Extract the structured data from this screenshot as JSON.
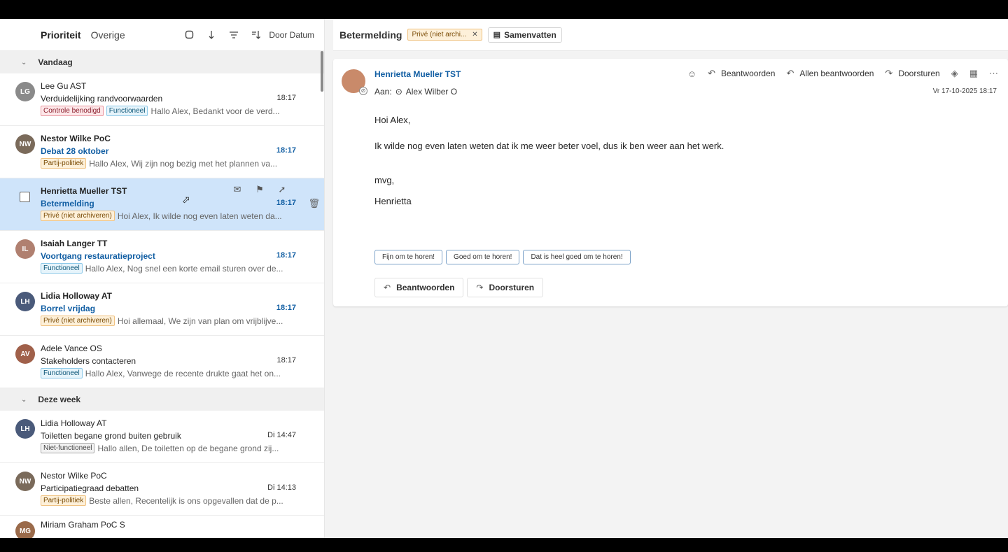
{
  "list": {
    "tabs": [
      "Prioriteit",
      "Overige"
    ],
    "sort_label": "Door Datum",
    "groups": {
      "today": "Vandaag",
      "week": "Deze week"
    },
    "items": [
      {
        "sender": "Lee Gu AST",
        "subject": "Verduidelijking randvoorwaarden",
        "time": "18:17",
        "tags": [
          "Controle benodigd",
          "Functioneel"
        ],
        "preview": "Hallo Alex, Bedankt voor de verd..."
      },
      {
        "sender": "Nestor Wilke PoC",
        "subject": "Debat 28 oktober",
        "time": "18:17",
        "tags": [
          "Partij-politiek"
        ],
        "preview": "Hallo Alex, Wij zijn nog bezig met het plannen va..."
      },
      {
        "sender": "Henrietta Mueller TST",
        "subject": "Betermelding",
        "time": "18:17",
        "tags": [
          "Privé (niet archiveren)"
        ],
        "preview": "Hoi Alex, Ik wilde nog even laten weten da..."
      },
      {
        "sender": "Isaiah Langer TT",
        "subject": "Voortgang restauratieproject",
        "time": "18:17",
        "tags": [
          "Functioneel"
        ],
        "preview": "Hallo Alex, Nog snel een korte email sturen over de..."
      },
      {
        "sender": "Lidia Holloway AT",
        "subject": "Borrel vrijdag",
        "time": "18:17",
        "tags": [
          "Privé (niet archiveren)"
        ],
        "preview": "Hoi allemaal, We zijn van plan om vrijblijve..."
      },
      {
        "sender": "Adele Vance OS",
        "subject": "Stakeholders contacteren",
        "time": "18:17",
        "tags": [
          "Functioneel"
        ],
        "preview": "Hallo Alex, Vanwege de recente drukte gaat het on..."
      },
      {
        "sender": "Lidia Holloway AT",
        "subject": "Toiletten begane grond buiten gebruik",
        "time": "Di 14:47",
        "tags": [
          "Niet-functioneel"
        ],
        "preview": "Hallo allen, De toiletten op de begane grond zij..."
      },
      {
        "sender": "Nestor Wilke PoC",
        "subject": "Participatiegraad debatten",
        "time": "Di 14:13",
        "tags": [
          "Partij-politiek"
        ],
        "preview": "Beste allen, Recentelijk is ons opgevallen dat de p..."
      },
      {
        "sender": "Miriam Graham PoC S",
        "subject": "",
        "time": "",
        "tags": [],
        "preview": ""
      }
    ]
  },
  "reading": {
    "subject": "Betermelding",
    "category_chip": "Privé (niet archi...",
    "summarize_label": "Samenvatten",
    "from": "Henrietta Mueller TST",
    "to_label": "Aan:",
    "to_name": "Alex Wilber O",
    "date": "Vr 17-10-2025 18:17",
    "actions": {
      "reply": "Beantwoorden",
      "reply_all": "Allen beantwoorden",
      "forward": "Doorsturen"
    },
    "body": {
      "greeting": "Hoi Alex,",
      "line1": "Ik wilde nog even laten weten dat ik me weer beter voel, dus ik ben weer aan het werk.",
      "closing": "mvg,",
      "signature": "Henrietta"
    },
    "suggestions": [
      "Fijn om te horen!",
      "Goed om te horen!",
      "Dat is heel goed om te horen!"
    ],
    "bottom_reply": "Beantwoorden",
    "bottom_forward": "Doorsturen"
  },
  "colors": {
    "accent": "#115ea3",
    "selected_row": "#cfe4fa"
  },
  "icons": [
    "select-all-icon",
    "sort-icon",
    "filter-icon",
    "sort-order-icon",
    "chevron-down-icon",
    "mark-read-icon",
    "flag-icon",
    "pin-icon",
    "trash-icon",
    "emoji-icon",
    "reply-icon",
    "reply-all-icon",
    "forward-icon",
    "sticker-icon",
    "apps-icon",
    "more-icon",
    "summarize-icon",
    "close-icon"
  ]
}
